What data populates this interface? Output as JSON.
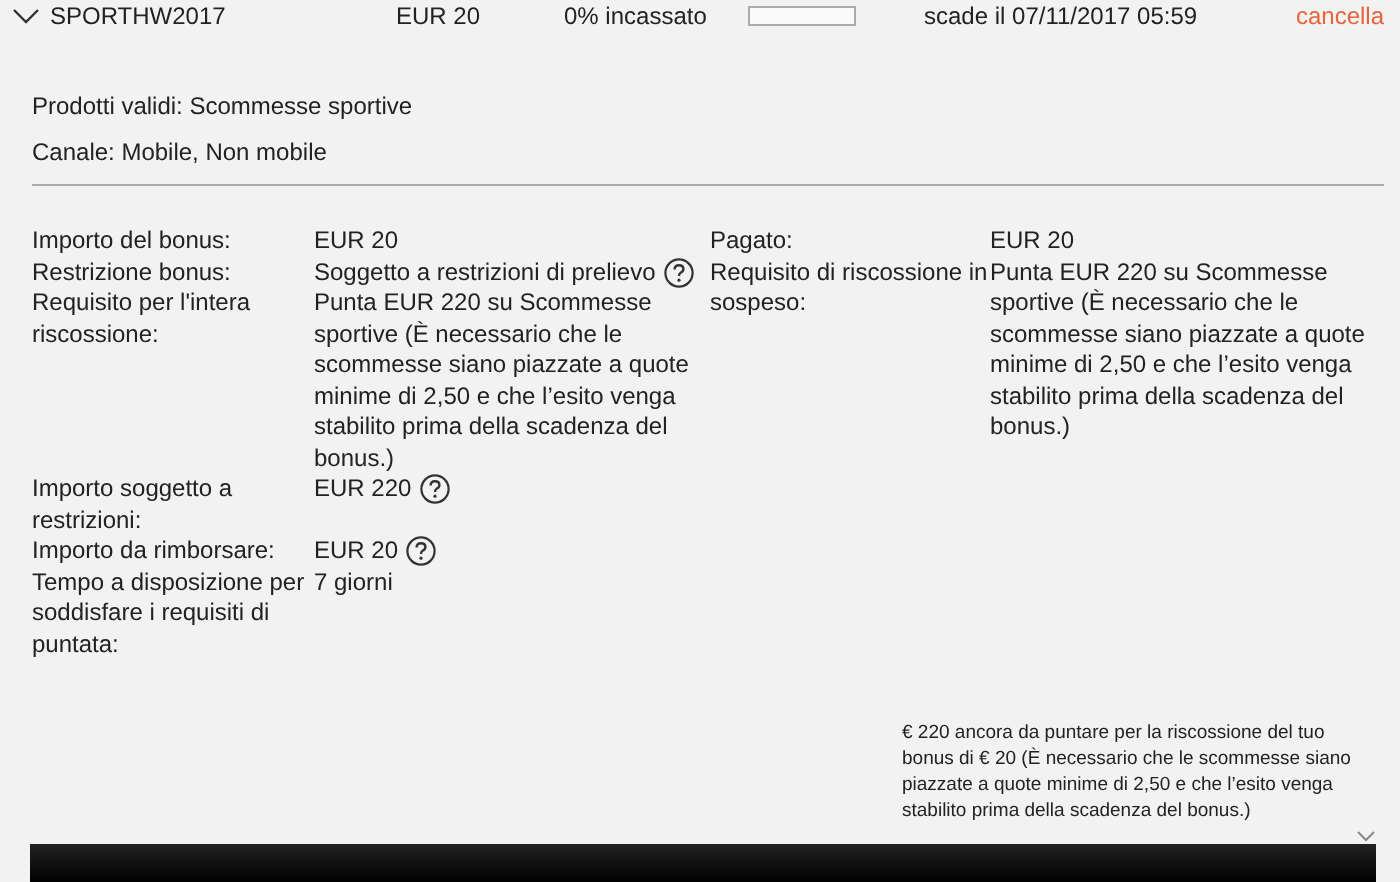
{
  "header": {
    "expanded": true,
    "code": "SPORTHW2017",
    "amount": "EUR 20",
    "status": "0% incassato",
    "level": 0,
    "expiry": "scade il 07/11/2017 05:59",
    "cancel": "cancella"
  },
  "info": [
    "Prodotti validi: Scommesse sportive",
    "Canale: Mobile, Non mobile"
  ],
  "details_left": [
    {
      "label": "Importo del bonus:",
      "value": "EUR 20",
      "help": false
    },
    {
      "label": "Restrizione bonus:",
      "value": "Soggetto a restrizioni di prelievo",
      "help": true
    },
    {
      "label": "Requisito per l'intera riscossione:",
      "value": "Punta EUR 220 su Scommesse sportive (È necessario che le scommesse siano piazzate a quote minime di 2,50 e che l’esito venga stabilito prima della scadenza del bonus.)",
      "help": false
    },
    {
      "label": "Importo soggetto a restrizioni:",
      "value": "EUR 220",
      "help": true
    },
    {
      "label": "Importo da rimborsare:",
      "value": "EUR 20",
      "help": true
    },
    {
      "label": "Tempo a disposizione per soddisfare i requisiti di puntata:",
      "value": "7 giorni",
      "help": false
    }
  ],
  "details_right": [
    {
      "label": "Pagato:",
      "value": "EUR 20",
      "help": false
    },
    {
      "label": "Requisito di riscossione in sospeso:",
      "value": "Punta EUR 220 su Scommesse sportive (È necessario che le scommesse siano piazzate a quote minime di 2,50 e che l’esito venga stabilito prima della scadenza del bonus.)",
      "help": false
    }
  ],
  "note": "€ 220 ancora da puntare per la riscossione del tuo bonus di € 20 (È necessario che le scommesse siano piazzate a quote minime di 2,50 e che l’esito venga stabilito prima della scadenza del bonus.)"
}
